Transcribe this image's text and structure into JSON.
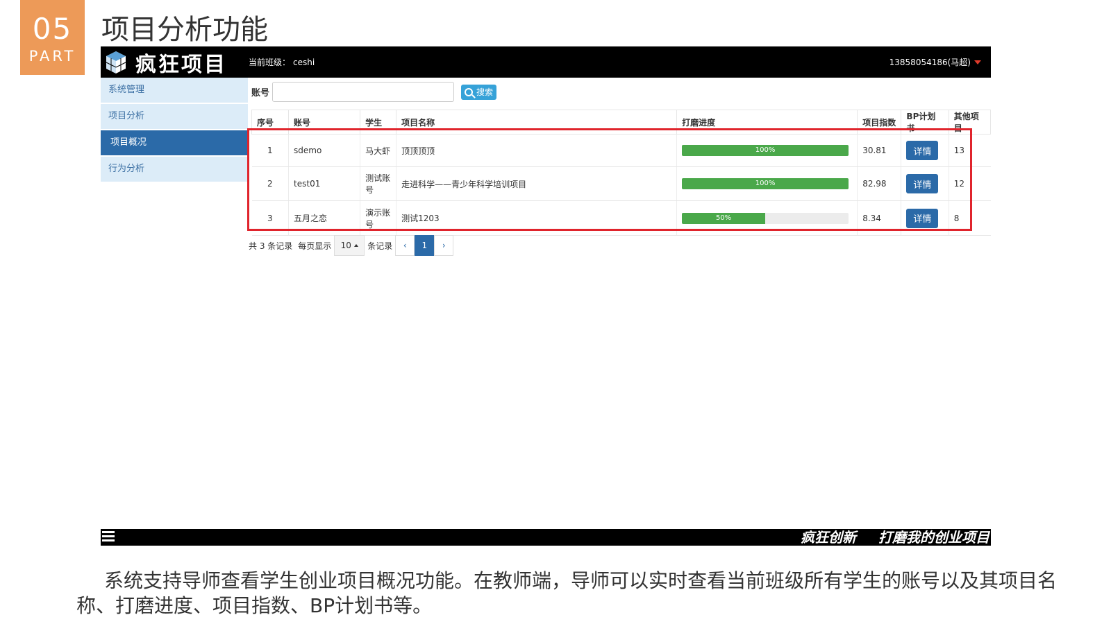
{
  "slide": {
    "part_number": "05",
    "part_label": "PART",
    "title": "项目分析功能",
    "description": "系统支持导师查看学生创业项目概况功能。在教师端，导师可以实时查看当前班级所有学生的账号以及其项目名称、打磨进度、项目指数、BP计划书等。"
  },
  "app": {
    "brand": "疯狂项目",
    "current_class_label": "当前班级：",
    "current_class_value": "ceshi",
    "user": "13858054186(马超)"
  },
  "sidebar": {
    "items": [
      {
        "label": "系统管理",
        "active": false
      },
      {
        "label": "项目分析",
        "active": false
      },
      {
        "label": "项目概况",
        "active": true
      },
      {
        "label": "行为分析",
        "active": false
      }
    ]
  },
  "search": {
    "label": "账号",
    "value": "",
    "button": "搜索"
  },
  "table": {
    "headers": [
      "序号",
      "账号",
      "学生",
      "项目名称",
      "打磨进度",
      "项目指数",
      "BP计划书",
      "其他项目"
    ],
    "rows": [
      {
        "no": "1",
        "account": "sdemo",
        "student": "马大虾",
        "project": "顶顶顶顶",
        "progress": 100,
        "progress_label": "100%",
        "index": "30.81",
        "bp": "详情",
        "other": "13"
      },
      {
        "no": "2",
        "account": "test01",
        "student": "测试账号",
        "project": "走进科学——青少年科学培训项目",
        "progress": 100,
        "progress_label": "100%",
        "index": "82.98",
        "bp": "详情",
        "other": "12"
      },
      {
        "no": "3",
        "account": "五月之恋",
        "student": "演示账号",
        "project": "测试1203",
        "progress": 50,
        "progress_label": "50%",
        "index": "8.34",
        "bp": "详情",
        "other": "8"
      }
    ]
  },
  "pagination": {
    "total_text": "共 3 条记录",
    "per_page_label": "每页显示",
    "page_size": "10",
    "records_suffix": "条记录",
    "prev": "‹",
    "current_page": "1",
    "next": "›"
  },
  "banner": {
    "slogan_1": "疯狂创新",
    "slogan_2": "打磨我的创业项目"
  },
  "colors": {
    "badge": "#ed9a58",
    "highlight": "#e0242c",
    "primary": "#2b6aa8",
    "progress": "#4aa84a"
  }
}
